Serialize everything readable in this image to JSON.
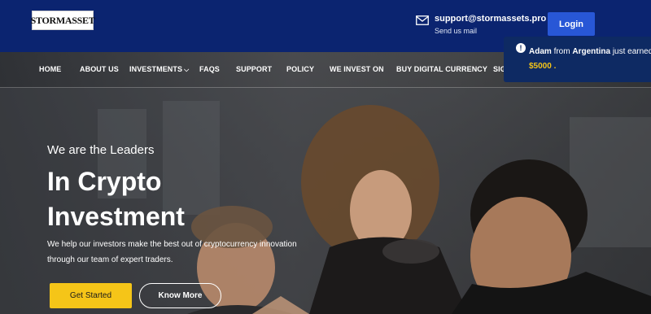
{
  "brand": {
    "logo_text": "STORMASSET"
  },
  "contact": {
    "email": "support@stormassets.pro",
    "email_caption": "Send us mail"
  },
  "header": {
    "login_label": "Login"
  },
  "nav": {
    "items": [
      "HOME",
      "ABOUT US",
      "INVESTMENTS",
      "FAQS",
      "SUPPORT",
      "POLICY",
      "WE INVEST ON",
      "BUY DIGITAL CURRENCY",
      "SIG"
    ]
  },
  "hero": {
    "kicker": "We are the Leaders",
    "title_line1": "In Crypto",
    "title_line2": "Investment",
    "desc_line1": "We help our investors make the best out of cryptocurrency innovation",
    "desc_line2": "through our team of expert traders.",
    "primary_button": "Get Started",
    "secondary_button": "Know More"
  },
  "notification": {
    "name": "Adam",
    "from_text": "from",
    "country": "Argentina",
    "action_text": "just earned",
    "amount": "$5000 ."
  },
  "colors": {
    "header_bg": "#0b2470",
    "login_bg": "#2857d6",
    "accent_yellow": "#f5c518",
    "toast_bg": "#0e2a63"
  },
  "icons": [
    "mail-icon",
    "chevron-down-icon",
    "info-icon"
  ]
}
